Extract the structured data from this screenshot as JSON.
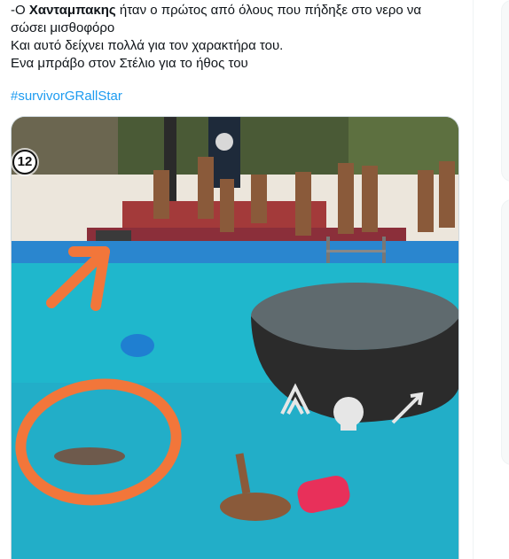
{
  "tweet": {
    "line1_prefix": "-Ο ",
    "line1_bold": "Χανταμπακης",
    "line1_rest": " ήταν ο πρώτος από όλους που πήδηξε στο νερο να",
    "line2": "σώσει μισθοφόρο",
    "line3": "Και αυτό δείχνει πολλά για τον χαρακτήρα του.",
    "line4": "Ενα μπράβο στον Στέλιο για το ήθος του",
    "hashtag": "#survivorGRallStar"
  },
  "media": {
    "badge": "12",
    "description_icons": [
      "skull-icon",
      "arrow-icon"
    ],
    "colors": {
      "pool": "#1fb7cc",
      "annotation": "#f2763a",
      "platform": "#2b2b2b",
      "buoy_pink": "#e8305a",
      "buoy_blue": "#1f7fd1"
    }
  }
}
